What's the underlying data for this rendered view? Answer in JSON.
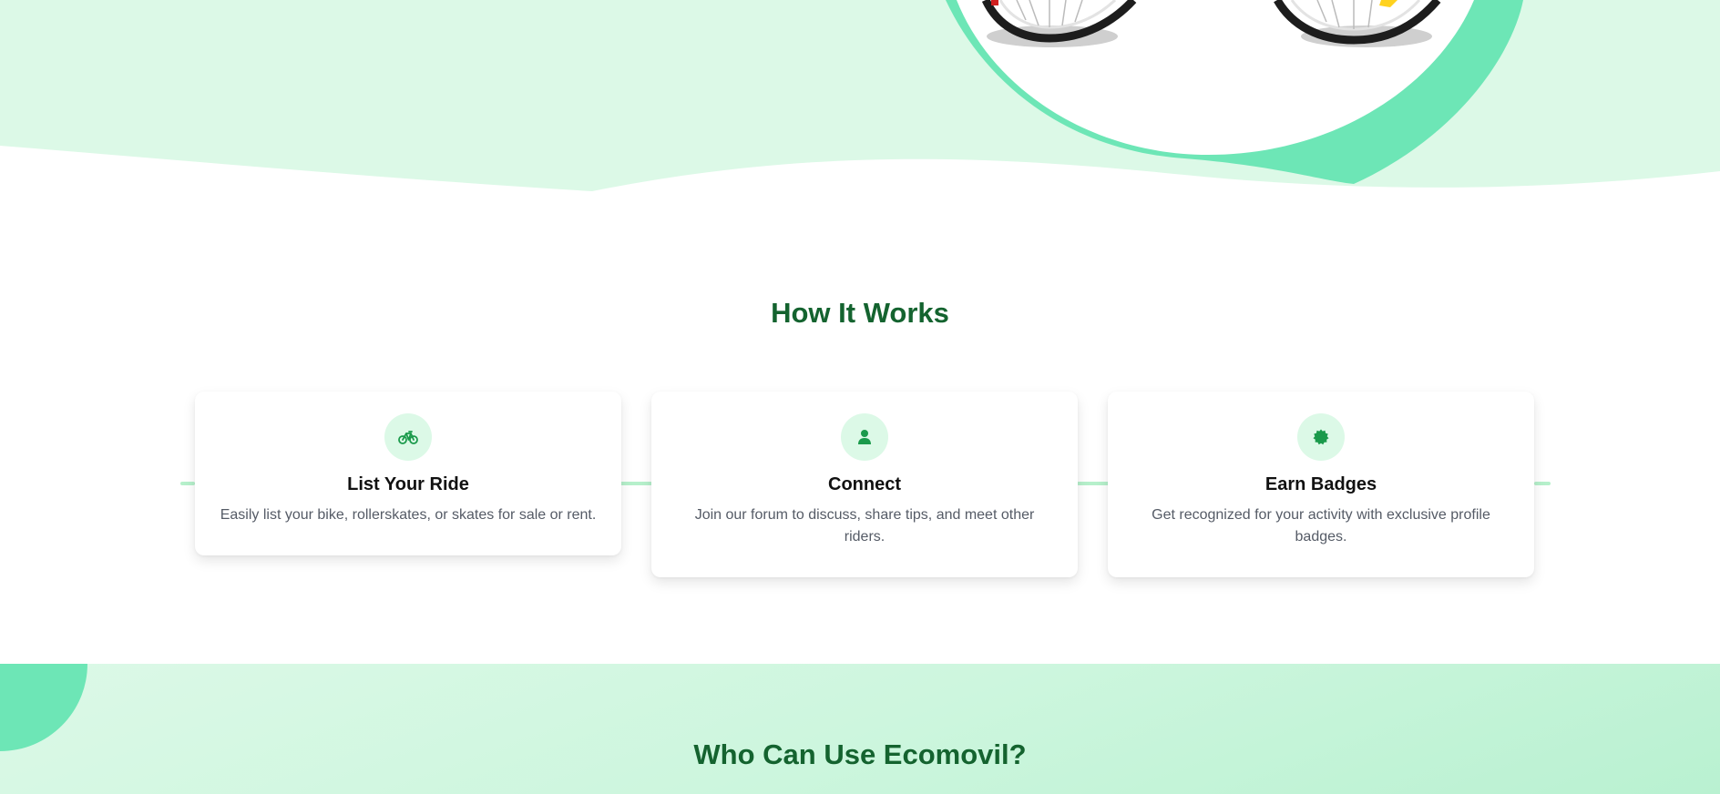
{
  "hero": {
    "colors": {
      "mint": "#dcf9e7",
      "accent": "#6de6b6",
      "tire": "#1d1d1d"
    },
    "image_subject": "bicycle"
  },
  "how_it_works": {
    "title": "How It Works",
    "cards": [
      {
        "icon": "bike-icon",
        "title": "List Your Ride",
        "description": "Easily list your bike, rollerskates, or skates for sale or rent."
      },
      {
        "icon": "user-icon",
        "title": "Connect",
        "description": "Join our forum to discuss, share tips, and meet other riders."
      },
      {
        "icon": "badge-icon",
        "title": "Earn Badges",
        "description": "Get recognized for your activity with exclusive profile badges."
      }
    ]
  },
  "who_can_use": {
    "title": "Who Can Use Ecomovil?"
  },
  "colors": {
    "heading": "#14632f",
    "icon": "#1a9a4b",
    "icon_bg": "#dcf9e7",
    "connector": "#b6f0cb",
    "body_text": "#555b66"
  }
}
